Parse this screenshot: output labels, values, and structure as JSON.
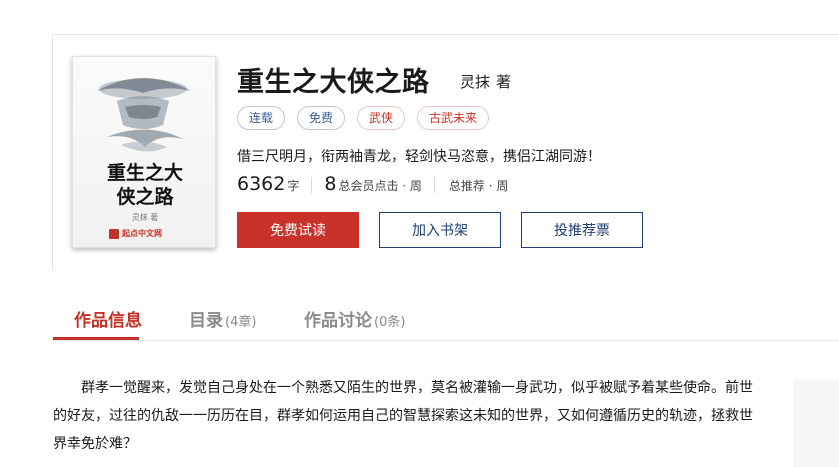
{
  "book": {
    "cover": {
      "title_line1": "重生之大",
      "title_line2": "侠之路",
      "author": "灵抹 著",
      "brand": "起点中文网"
    },
    "title": "重生之大侠之路",
    "author": "灵抹",
    "author_suffix": "著",
    "tags": [
      "连载",
      "免费",
      "武侠",
      "古武未来"
    ],
    "intro": "借三尺明月，衔两袖青龙，轻剑快马恣意，携侣江湖同游！",
    "stats": {
      "word_count": "6362",
      "word_unit": "字",
      "clicks": "8",
      "clicks_label": "总会员点击 · 周",
      "recommend_label": "总推荐 · 周"
    },
    "buttons": {
      "free_read": "免费试读",
      "add_shelf": "加入书架",
      "vote": "投推荐票"
    }
  },
  "tabs": [
    {
      "label": "作品信息",
      "count": ""
    },
    {
      "label": "目录",
      "count": "(4章)"
    },
    {
      "label": "作品讨论",
      "count": "(0条)"
    }
  ],
  "description": "群孝一觉醒来，发觉自己身处在一个熟悉又陌生的世界，莫名被灌输一身武功，似乎被赋予着某些使命。前世的好友，过往的仇敌一一历历在目，群孝如何运用自己的智慧探索这未知的世界，又如何遵循历史的轨迹，拯救世界幸免於难？",
  "colors": {
    "accent_red": "#c8322a",
    "navy": "#1d3f74",
    "tag_blue": "#3a5f93"
  }
}
